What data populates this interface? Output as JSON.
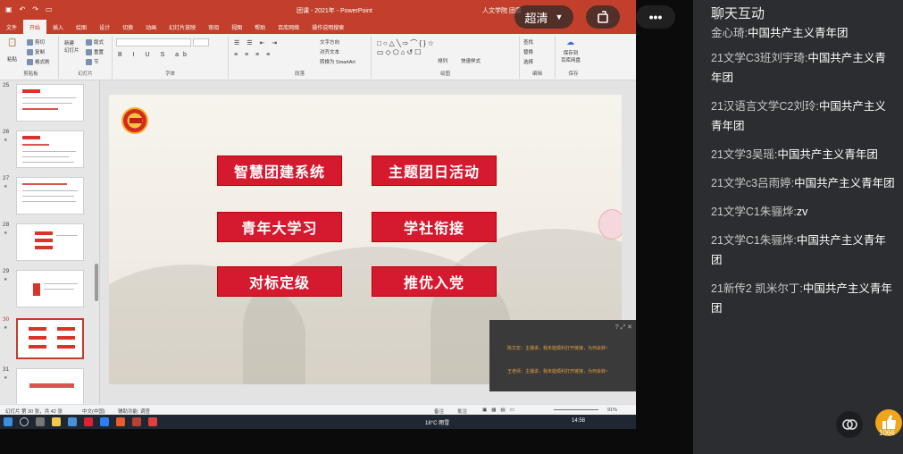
{
  "ppt": {
    "doc_title": "团课 - 2021年  -  PowerPoint",
    "user": "人文学院 团委",
    "tabs": [
      "文件",
      "开始",
      "插入",
      "绘图",
      "设计",
      "切换",
      "动画",
      "幻灯片放映",
      "审阅",
      "视图",
      "帮助",
      "百库网络",
      "操作说明搜索"
    ],
    "active_tab": "开始",
    "ribbon": {
      "groups": [
        "剪贴板",
        "幻灯片",
        "字体",
        "段落",
        "绘图",
        "编辑",
        "保存"
      ],
      "paste": "粘贴",
      "cut": "剪切",
      "copy": "复制",
      "format_painter": "格式刷",
      "new_slide": "新建\n幻灯片",
      "layout": "版式",
      "reset": "重置",
      "section": "节",
      "text_direction": "文字方向",
      "align_text": "对齐文本",
      "smartart": "转换为 SmartArt",
      "arrange": "排列",
      "quick_styles": "快速样式",
      "find": "查找",
      "replace": "替换",
      "select": "选择",
      "save_to": "保存到\n百库网盘"
    },
    "thumbnails": [
      {
        "num": "25"
      },
      {
        "num": "26"
      },
      {
        "num": "27"
      },
      {
        "num": "28"
      },
      {
        "num": "29"
      },
      {
        "num": "30",
        "selected": true
      },
      {
        "num": "31"
      }
    ],
    "slide_buttons": [
      "智慧团建系统",
      "主题团日活动",
      "青年大学习",
      "学社衔接",
      "对标定级",
      "推优入党"
    ],
    "popup_lines": [
      "陈文宏：主播讲，我未能顺利打开链接，为何会转~",
      "王老师：主播讲，我未能顺利打开链接，为何会转~"
    ],
    "status": {
      "slide_info": "幻灯片 第 30 张，共 42 张",
      "lang": "中文(中国)",
      "accessibility": "辅助功能: 调查",
      "notes": "备注",
      "comments": "批注",
      "zoom": "91%"
    },
    "taskbar": {
      "weather": "18°C 雨雪",
      "time": "14:58"
    }
  },
  "overlay": {
    "quality": "超清",
    "more": "•••"
  },
  "chat": {
    "title": "聊天互动",
    "clipped_first": {
      "name": "金心琦:",
      "text": "中国共产主义青年团"
    },
    "messages": [
      {
        "name": "21文学C3班刘宇琦:",
        "text": "中国共产主义青年团"
      },
      {
        "name": "21汉语言文学C2刘玲:",
        "text": "中国共产主义青年团"
      },
      {
        "name": "21文学3吴瑶:",
        "text": "中国共产主义青年团"
      },
      {
        "name": "21文学c3吕雨婷:",
        "text": "中国共产主义青年团"
      },
      {
        "name": "21文学C1朱骊烨:",
        "text": "zv"
      },
      {
        "name": "21文学C1朱骊烨:",
        "text": "中国共产主义青年团"
      },
      {
        "name": "21新传2 凯米尔丁:",
        "text": "中国共产主义青年团"
      }
    ],
    "like_count": "1066"
  }
}
